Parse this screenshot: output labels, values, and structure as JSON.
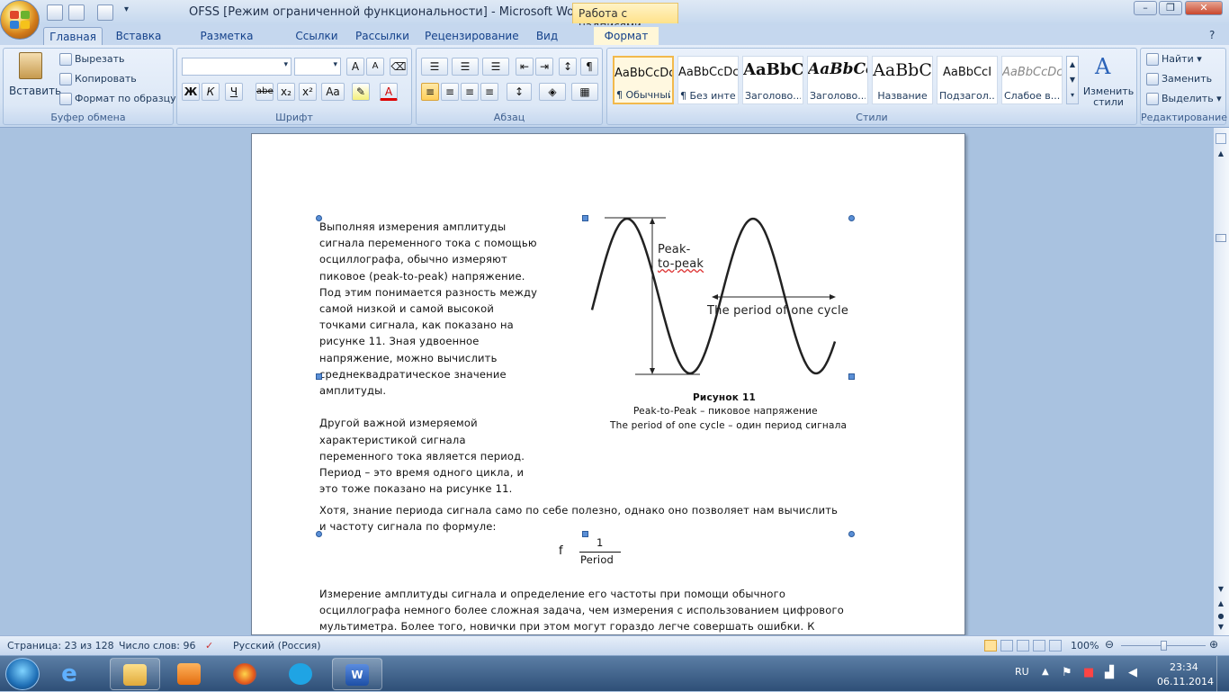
{
  "window": {
    "title": "OFSS [Режим ограниченной функциональности] - Microsoft Word",
    "context_tab": "Работа с надписями"
  },
  "tabs": [
    "Главная",
    "Вставка",
    "Разметка страницы",
    "Ссылки",
    "Рассылки",
    "Рецензирование",
    "Вид",
    "Формат"
  ],
  "ribbon": {
    "clipboard": {
      "paste": "Вставить",
      "cut": "Вырезать",
      "copy": "Копировать",
      "format_painter": "Формат по образцу",
      "label": "Буфер обмена"
    },
    "font": {
      "bold": "Ж",
      "italic": "К",
      "underline": "Ч",
      "strike": "abe",
      "sub": "x₂",
      "sup": "x²",
      "case": "Aa",
      "grow": "A",
      "shrink": "A",
      "label": "Шрифт"
    },
    "paragraph": {
      "label": "Абзац"
    },
    "styles": {
      "label": "Стили",
      "items": [
        {
          "sample": "AaBbCcDc",
          "name": "¶ Обычный"
        },
        {
          "sample": "AaBbCcDc",
          "name": "¶ Без инте..."
        },
        {
          "sample": "AaBbC",
          "name": "Заголово..."
        },
        {
          "sample": "AaBbCc",
          "name": "Заголово..."
        },
        {
          "sample": "AaBbC",
          "name": "Название"
        },
        {
          "sample": "AaBbCcI",
          "name": "Подзагол..."
        },
        {
          "sample": "AaBbCcDc",
          "name": "Слабое в..."
        }
      ],
      "change": "Изменить стили"
    },
    "editing": {
      "find": "Найти",
      "replace": "Заменить",
      "select": "Выделить",
      "label": "Редактирование"
    }
  },
  "document": {
    "left_col": [
      "Выполняя измерения амплитуды",
      "сигнала переменного тока с помощью",
      "осциллографа, обычно измеряют",
      "пиковое (peak-to-peak) напряжение.",
      "Под этим понимается разность между",
      "самой низкой и самой высокой",
      "точками сигнала, как показано на",
      "рисунке 11. Зная удвоенное",
      "напряжение, можно вычислить",
      "среднеквадратическое значение",
      "амплитуды.",
      "",
      "Другой важной измеряемой",
      "характеристикой сигнала",
      "переменного тока является период.",
      "Период – это время одного цикла, и",
      "это тоже показано на рисунке 11."
    ],
    "full_lines": [
      "Хотя, знание периода сигнала само по себе полезно, однако оно позволяет нам вычислить",
      "и частоту сигнала по формуле:"
    ],
    "figure": {
      "peak_label_1": "Peak-",
      "peak_label_2": "to-peak",
      "period_label": "The period of one cycle",
      "caption_title": "Рисунок 11",
      "caption_line1": "Peak-to-Peak – пиковое напряжение",
      "caption_line2": "The period of one cycle – один период сигнала"
    },
    "formula": {
      "lhs": "f",
      "num": "1",
      "den": "Period"
    },
    "bottom_lines": [
      "Измерение амплитуды сигнала и определение его частоты при помощи обычного",
      "осциллографа немного более сложная задача, чем измерения с использованием цифрового",
      "мультиметра. Более того, новички при этом могут гораздо легче совершать ошибки. К"
    ]
  },
  "status": {
    "page": "Страница: 23 из 128",
    "words": "Число слов: 96",
    "lang": "Русский (Россия)",
    "zoom": "100%"
  },
  "taskbar": {
    "lang": "RU",
    "time": "23:34",
    "date": "06.11.2014"
  }
}
